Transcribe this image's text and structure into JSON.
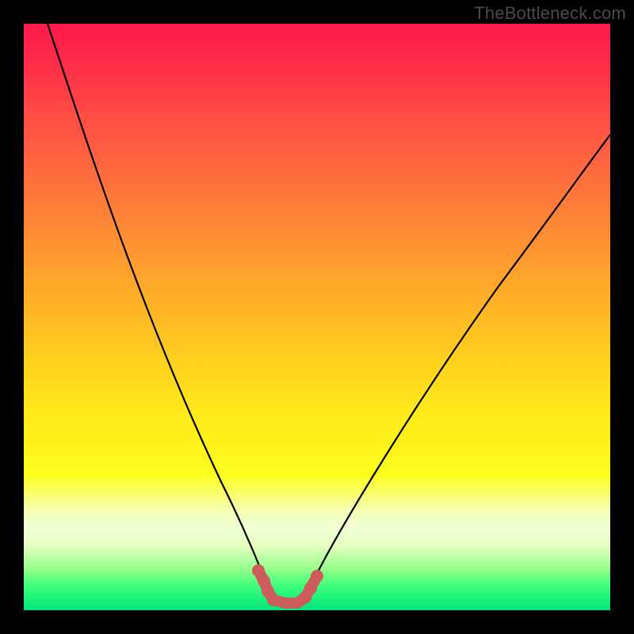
{
  "watermark": "TheBottleneck.com",
  "colors": {
    "page_bg": "#000000",
    "watermark_text": "#4a4a4a",
    "curve_stroke": "#000000",
    "marker_stroke": "#cd5c5c",
    "marker_fill": "#cd5c5c",
    "gradient_top": "#ff1a4b",
    "gradient_bottom": "#00e67a"
  },
  "chart_data": {
    "type": "line",
    "title": "",
    "xlabel": "",
    "ylabel": "",
    "xlim": [
      0,
      100
    ],
    "ylim": [
      0,
      100
    ],
    "grid": false,
    "legend": false,
    "series": [
      {
        "name": "bottleneck-curve",
        "x": [
          4,
          8,
          12,
          16,
          20,
          24,
          28,
          32,
          34,
          36,
          38,
          40,
          41,
          43,
          45,
          47,
          50,
          55,
          60,
          65,
          70,
          75,
          80,
          85,
          90,
          95,
          100
        ],
        "y": [
          100,
          90,
          80,
          70,
          61,
          52,
          43,
          34,
          28,
          22,
          16,
          10,
          6,
          3,
          2,
          2,
          3,
          9,
          16,
          23,
          30,
          37,
          43,
          49,
          55,
          60,
          64
        ]
      },
      {
        "name": "sweet-spot-markers",
        "x": [
          40,
          41,
          43,
          45,
          47,
          48,
          50
        ],
        "y": [
          10,
          6,
          3,
          2,
          2,
          3,
          6
        ]
      }
    ],
    "annotations": []
  }
}
